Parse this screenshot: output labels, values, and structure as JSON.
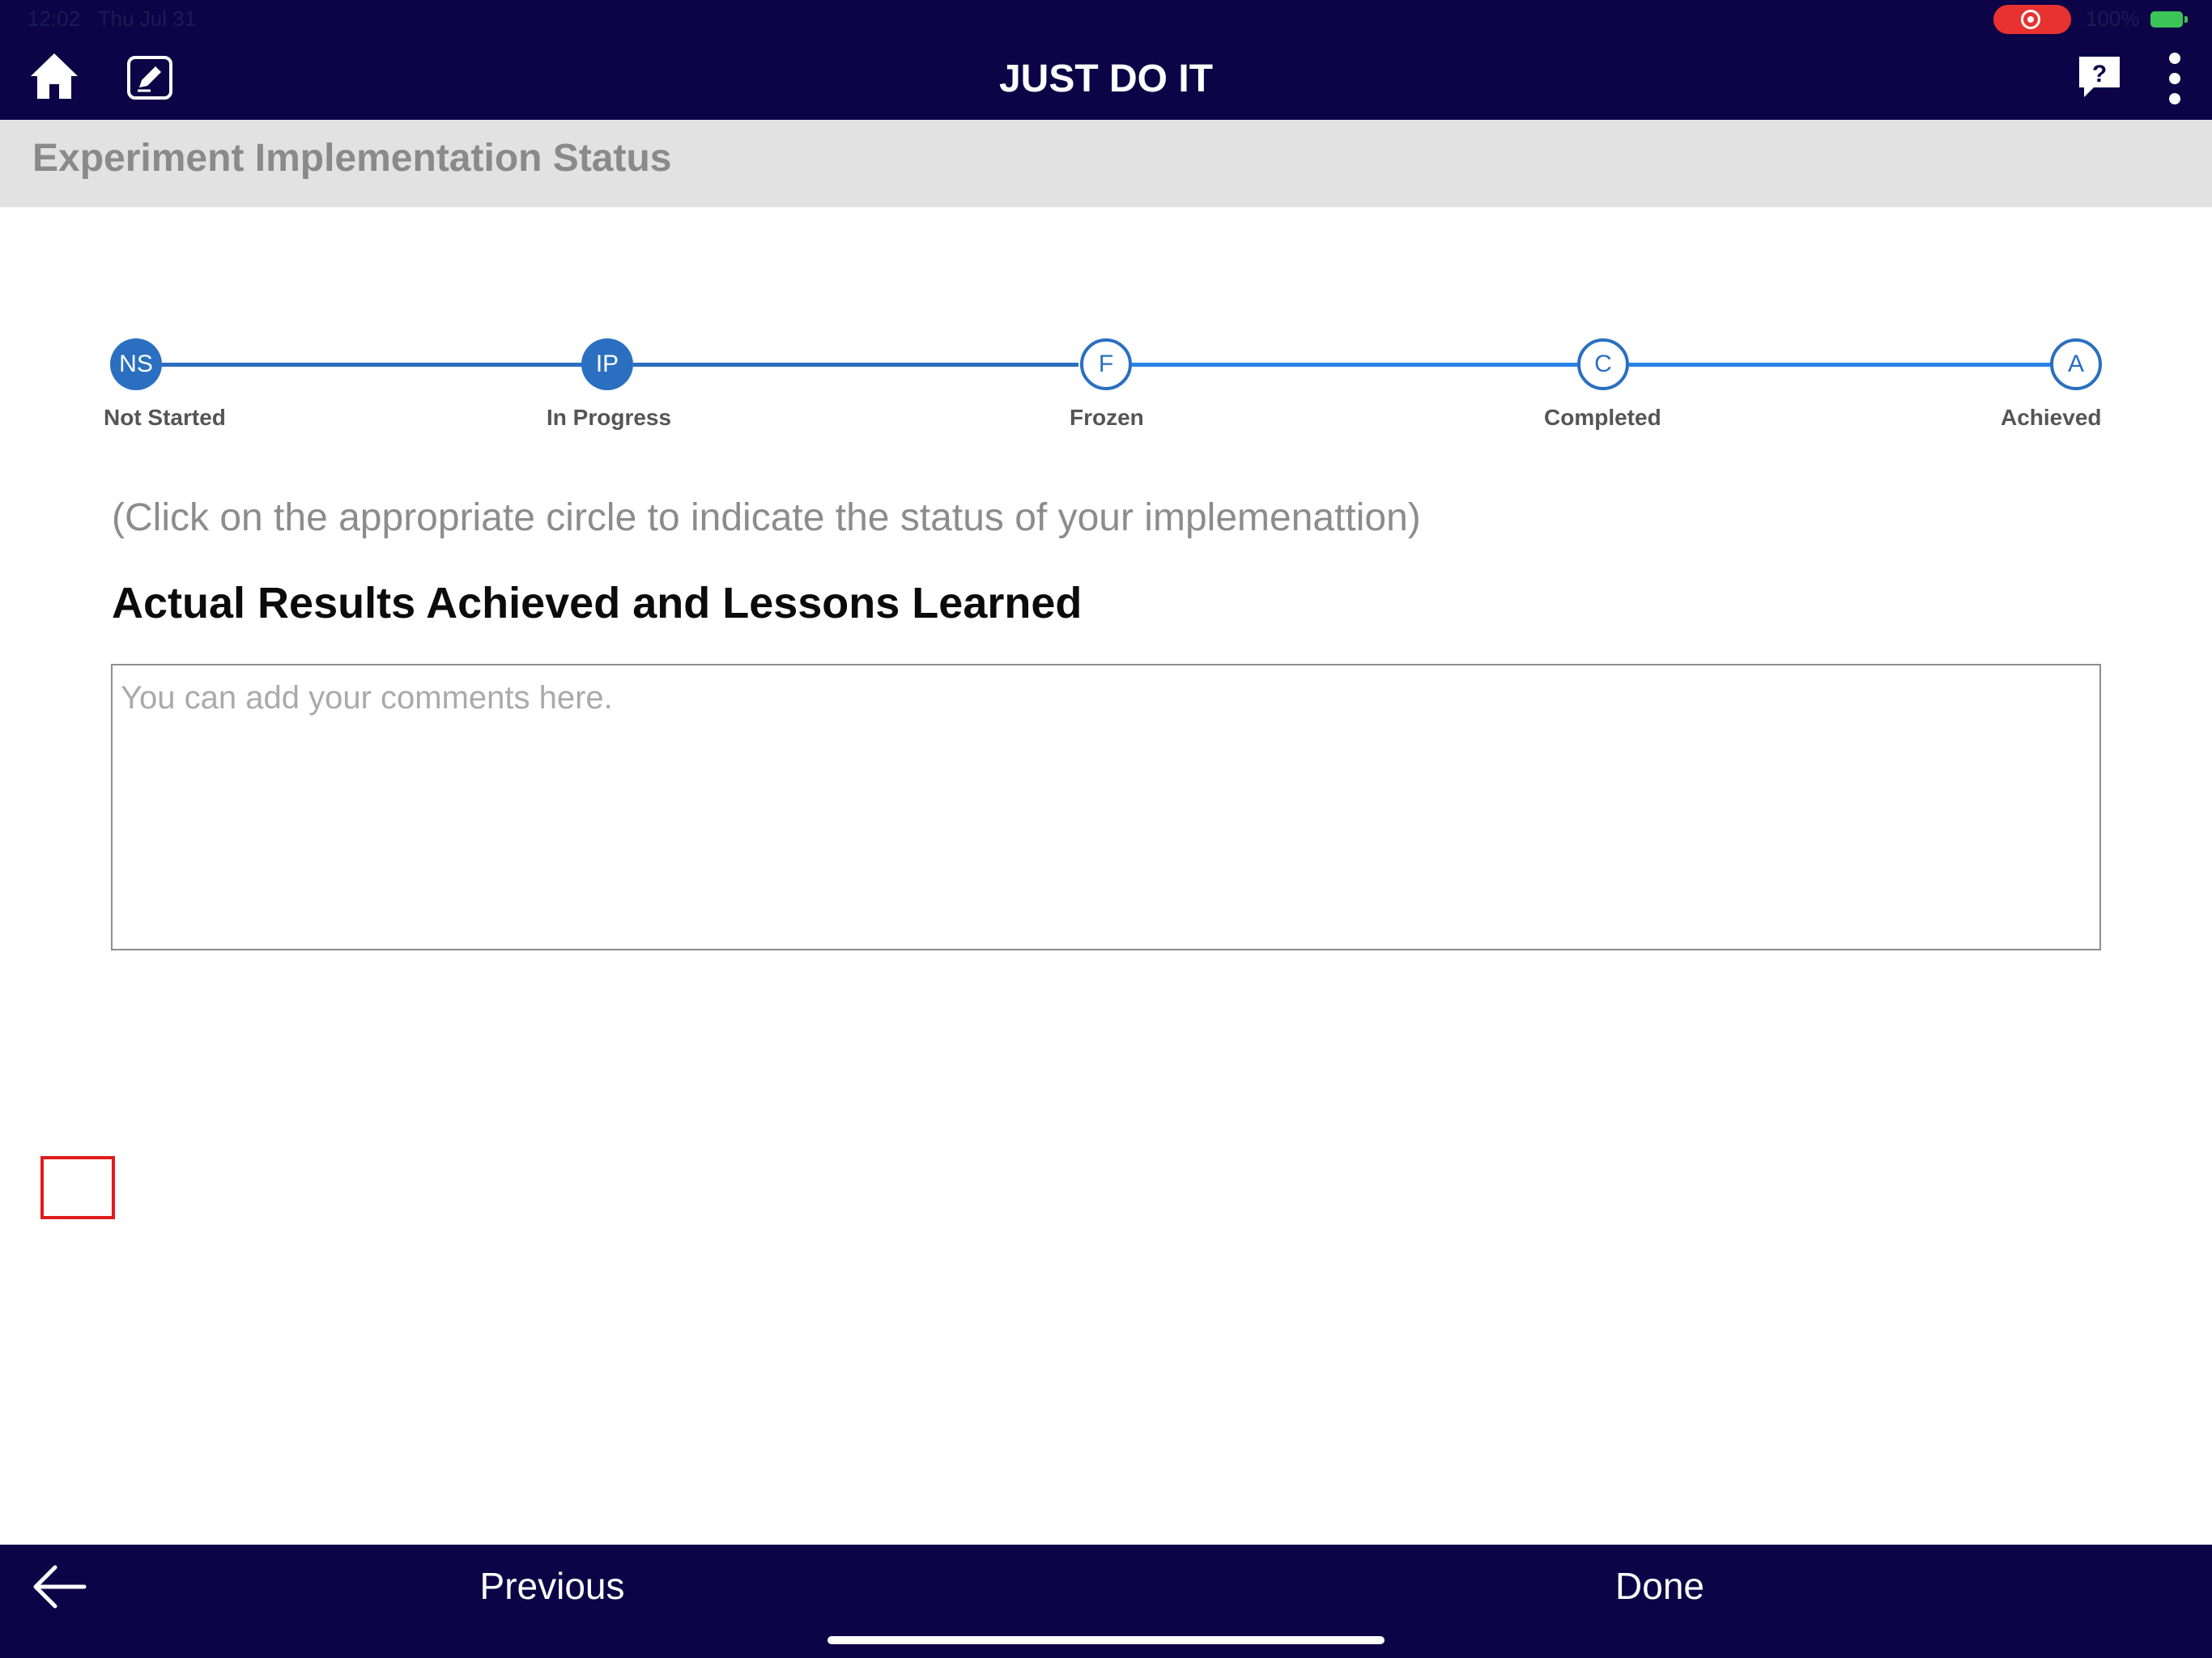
{
  "status_bar": {
    "time": "12:02",
    "date": "Thu Jul 31",
    "battery": "100%",
    "record_color": "#e8322f"
  },
  "header": {
    "title": "JUST DO IT",
    "icons": {
      "home": "home-icon",
      "edit": "edit-icon",
      "help": "help-icon",
      "menu": "more-vertical-icon"
    },
    "background": "#0c0447"
  },
  "section": {
    "title": "Experiment Implementation Status"
  },
  "stepper": {
    "accent": "#2a6fc0",
    "steps": [
      {
        "abbr": "NS",
        "label": "Not Started",
        "state": "filled"
      },
      {
        "abbr": "IP",
        "label": "In Progress",
        "state": "filled"
      },
      {
        "abbr": "F",
        "label": "Frozen",
        "state": "empty"
      },
      {
        "abbr": "C",
        "label": "Completed",
        "state": "empty"
      },
      {
        "abbr": "A",
        "label": "Achieved",
        "state": "empty"
      }
    ]
  },
  "hint": "(Click on the appropriate circle  to indicate the status of your implemenattion)",
  "results": {
    "heading": "Actual Results Achieved and Lessons Learned",
    "placeholder": "You can add your comments here.",
    "value": ""
  },
  "footer": {
    "back_icon": "arrow-left-icon",
    "previous_label": "Previous",
    "done_label": "Done"
  }
}
